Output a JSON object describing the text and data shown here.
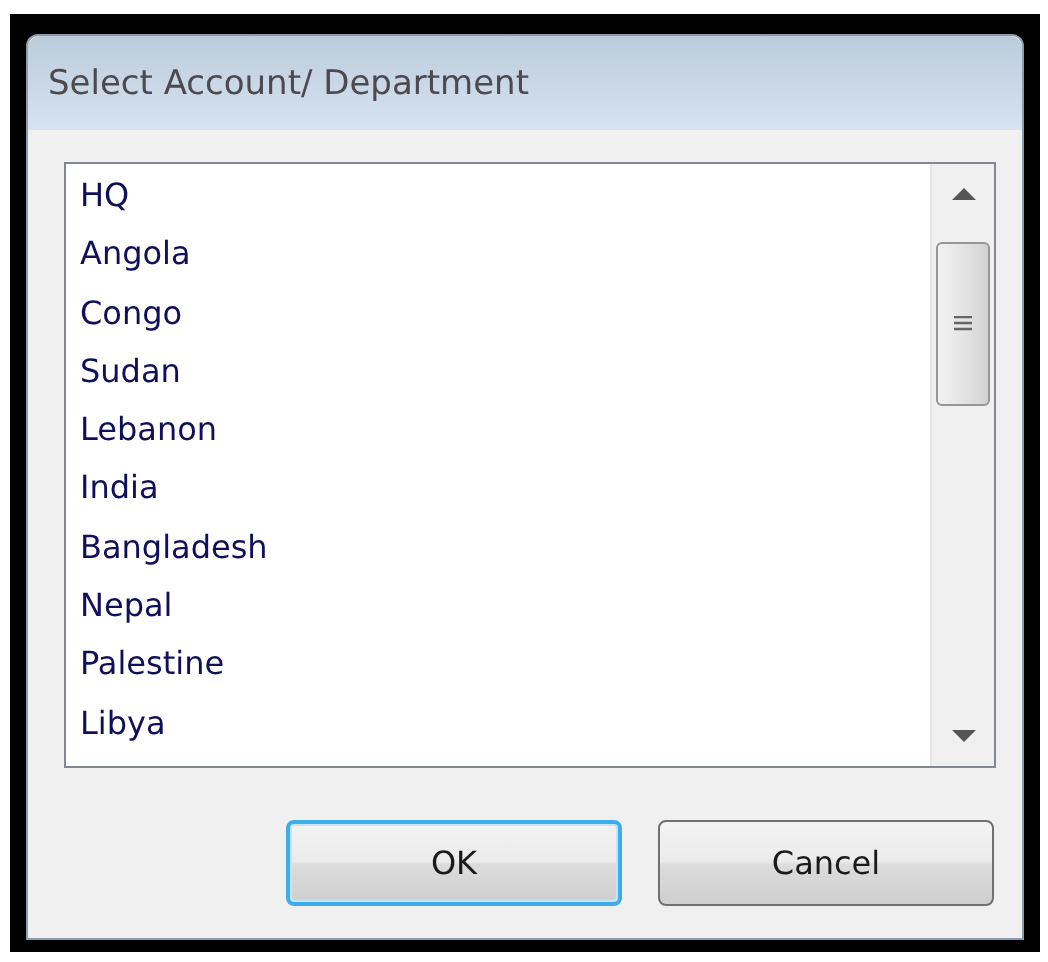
{
  "window": {
    "title": "Select Account/ Department"
  },
  "list": {
    "items": [
      {
        "label": "HQ",
        "selected": false
      },
      {
        "label": "Angola",
        "selected": false
      },
      {
        "label": "Congo",
        "selected": false
      },
      {
        "label": "Sudan",
        "selected": false
      },
      {
        "label": "Lebanon",
        "selected": false
      },
      {
        "label": "India",
        "selected": false
      },
      {
        "label": "Bangladesh",
        "selected": false
      },
      {
        "label": "Nepal",
        "selected": false
      },
      {
        "label": "Palestine",
        "selected": false
      },
      {
        "label": "Libya",
        "selected": false
      }
    ]
  },
  "buttons": [
    {
      "label": "OK",
      "default": true
    },
    {
      "label": "Cancel",
      "default": false
    }
  ]
}
